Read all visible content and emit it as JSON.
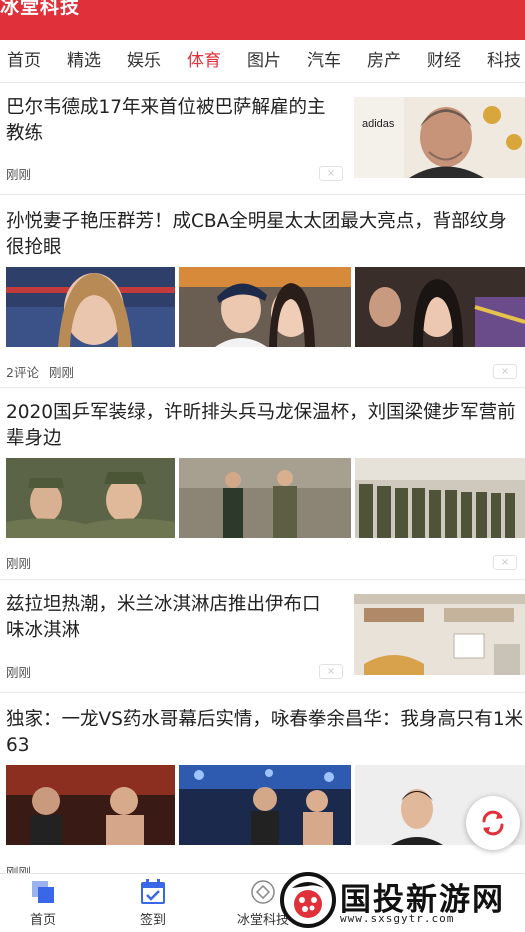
{
  "header": {
    "title": "冰堂科技"
  },
  "tabs": [
    "首页",
    "精选",
    "娱乐",
    "体育",
    "图片",
    "汽车",
    "房产",
    "财经",
    "科技"
  ],
  "active_tab": "体育",
  "colors": {
    "brand_red": "#e0313b",
    "active_tab": "#e0313b",
    "nav_blue": "#3a66e8"
  },
  "articles": [
    {
      "headline": "巴尔韦德成17年来首位被巴萨解雇的主教练",
      "meta": [
        "刚刚"
      ],
      "layout": "right-thumb"
    },
    {
      "headline": "孙悦妻子艳压群芳！成CBA全明星太太团最大亮点，背部纹身很抢眼",
      "meta": [
        "2评论",
        "刚刚"
      ],
      "layout": "three-thumbs"
    },
    {
      "headline": "2020国乒军装绿，许昕排头兵马龙保温杯，刘国梁健步军营前辈身边",
      "meta": [
        "刚刚"
      ],
      "layout": "three-thumbs"
    },
    {
      "headline": "兹拉坦热潮，米兰冰淇淋店推出伊布口味冰淇淋",
      "meta": [
        "刚刚"
      ],
      "layout": "right-thumb"
    },
    {
      "headline": "独家：一龙VS药水哥幕后实情，咏春拳余昌华：我身高只有1米63",
      "meta": [
        "刚刚"
      ],
      "layout": "three-thumbs"
    }
  ],
  "close_symbol": "×",
  "bottom_nav": [
    {
      "label": "首页",
      "icon": "home-squares-icon"
    },
    {
      "label": "签到",
      "icon": "calendar-check-icon"
    },
    {
      "label": "冰堂科技",
      "icon": "diamond-icon"
    }
  ],
  "watermark": {
    "text": "国投新游网",
    "url": "www.sxsgytr.com"
  }
}
